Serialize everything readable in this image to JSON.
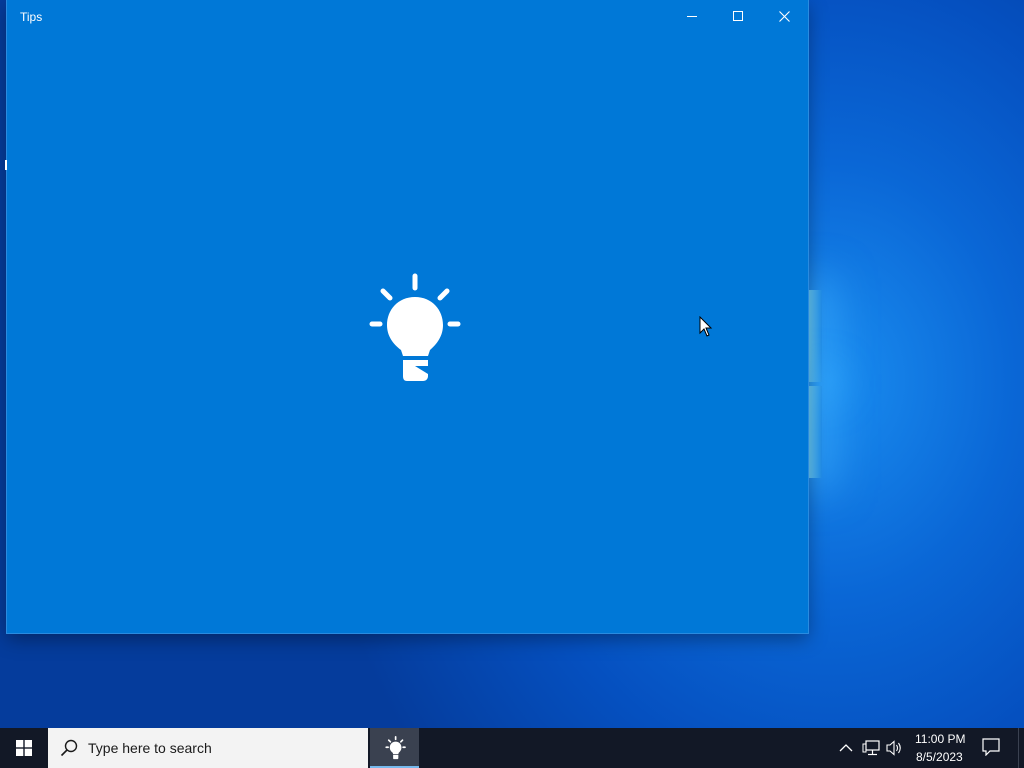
{
  "window": {
    "title": "Tips",
    "controls": {
      "minimize_icon": "minimize-icon",
      "maximize_icon": "maximize-icon",
      "close_icon": "close-icon"
    },
    "background_color": "#0078d7",
    "splash_icon": "lightbulb-icon"
  },
  "taskbar": {
    "start_icon": "windows-logo-icon",
    "search_placeholder": "Type here to search",
    "pinned_app_icon": "lightbulb-icon",
    "tray_icons": [
      "chevron-up-icon",
      "network-icon",
      "volume-icon"
    ],
    "clock_time": "11:00 PM",
    "clock_date": "8/5/2023",
    "notification_icon": "action-center-icon",
    "background_color": "#121826"
  }
}
